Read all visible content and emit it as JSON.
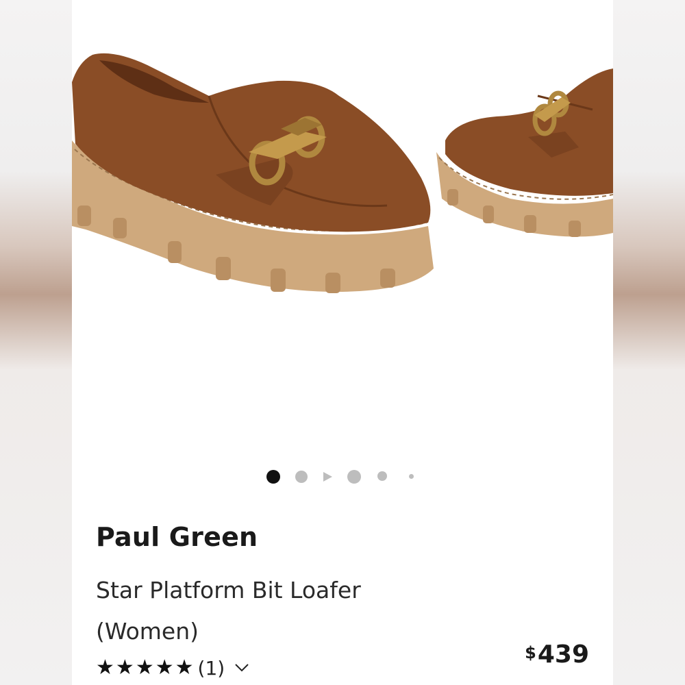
{
  "gallery": {
    "image_count": 5,
    "active_index": 0,
    "image_alt": "Paul Green Star Platform Bit Loafer in cognac suede"
  },
  "product": {
    "brand": "Paul Green",
    "name": "Star Platform Bit Loafer (Women)",
    "price_currency": "$",
    "price_amount": "439",
    "rating": {
      "stars": 5,
      "count_label": "(1)"
    }
  },
  "icons": {
    "star": "star-icon",
    "chevron": "chevron-down-icon",
    "play": "play-icon"
  },
  "colors": {
    "suede": "#8a4d26",
    "sole": "#cfa97d",
    "hardware": "#b0883f",
    "dot_active": "#111111",
    "dot_inactive": "#bdbdbd"
  }
}
